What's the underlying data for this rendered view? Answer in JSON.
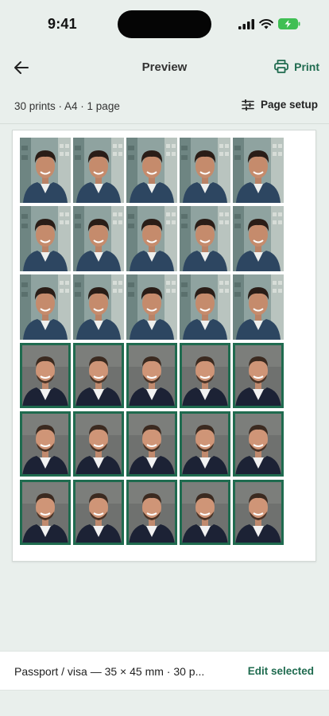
{
  "status_bar": {
    "time": "9:41"
  },
  "top_bar": {
    "title": "Preview",
    "print_label": "Print"
  },
  "summary": {
    "text": "30 prints · A4 · 1 page",
    "page_setup_label": "Page setup"
  },
  "sheet": {
    "rows": [
      [
        "photo-a",
        "photo-a",
        "photo-a",
        "photo-a",
        "photo-a"
      ],
      [
        "photo-a",
        "photo-a",
        "photo-a",
        "photo-a",
        "photo-a"
      ],
      [
        "photo-a",
        "photo-a",
        "photo-a",
        "photo-a",
        "photo-a"
      ],
      [
        "photo-b",
        "photo-b",
        "photo-b",
        "photo-b",
        "photo-b"
      ],
      [
        "photo-b",
        "photo-b",
        "photo-b",
        "photo-b",
        "photo-b"
      ],
      [
        "photo-b",
        "photo-b",
        "photo-b",
        "photo-b",
        "photo-b"
      ]
    ],
    "selected_photo": "photo-b"
  },
  "bottom_bar": {
    "description": "Passport / visa — 35 × 45 mm · 30 p...",
    "edit_label": "Edit selected"
  },
  "colors": {
    "accent": "#1f6b4f",
    "background": "#e9efec"
  }
}
